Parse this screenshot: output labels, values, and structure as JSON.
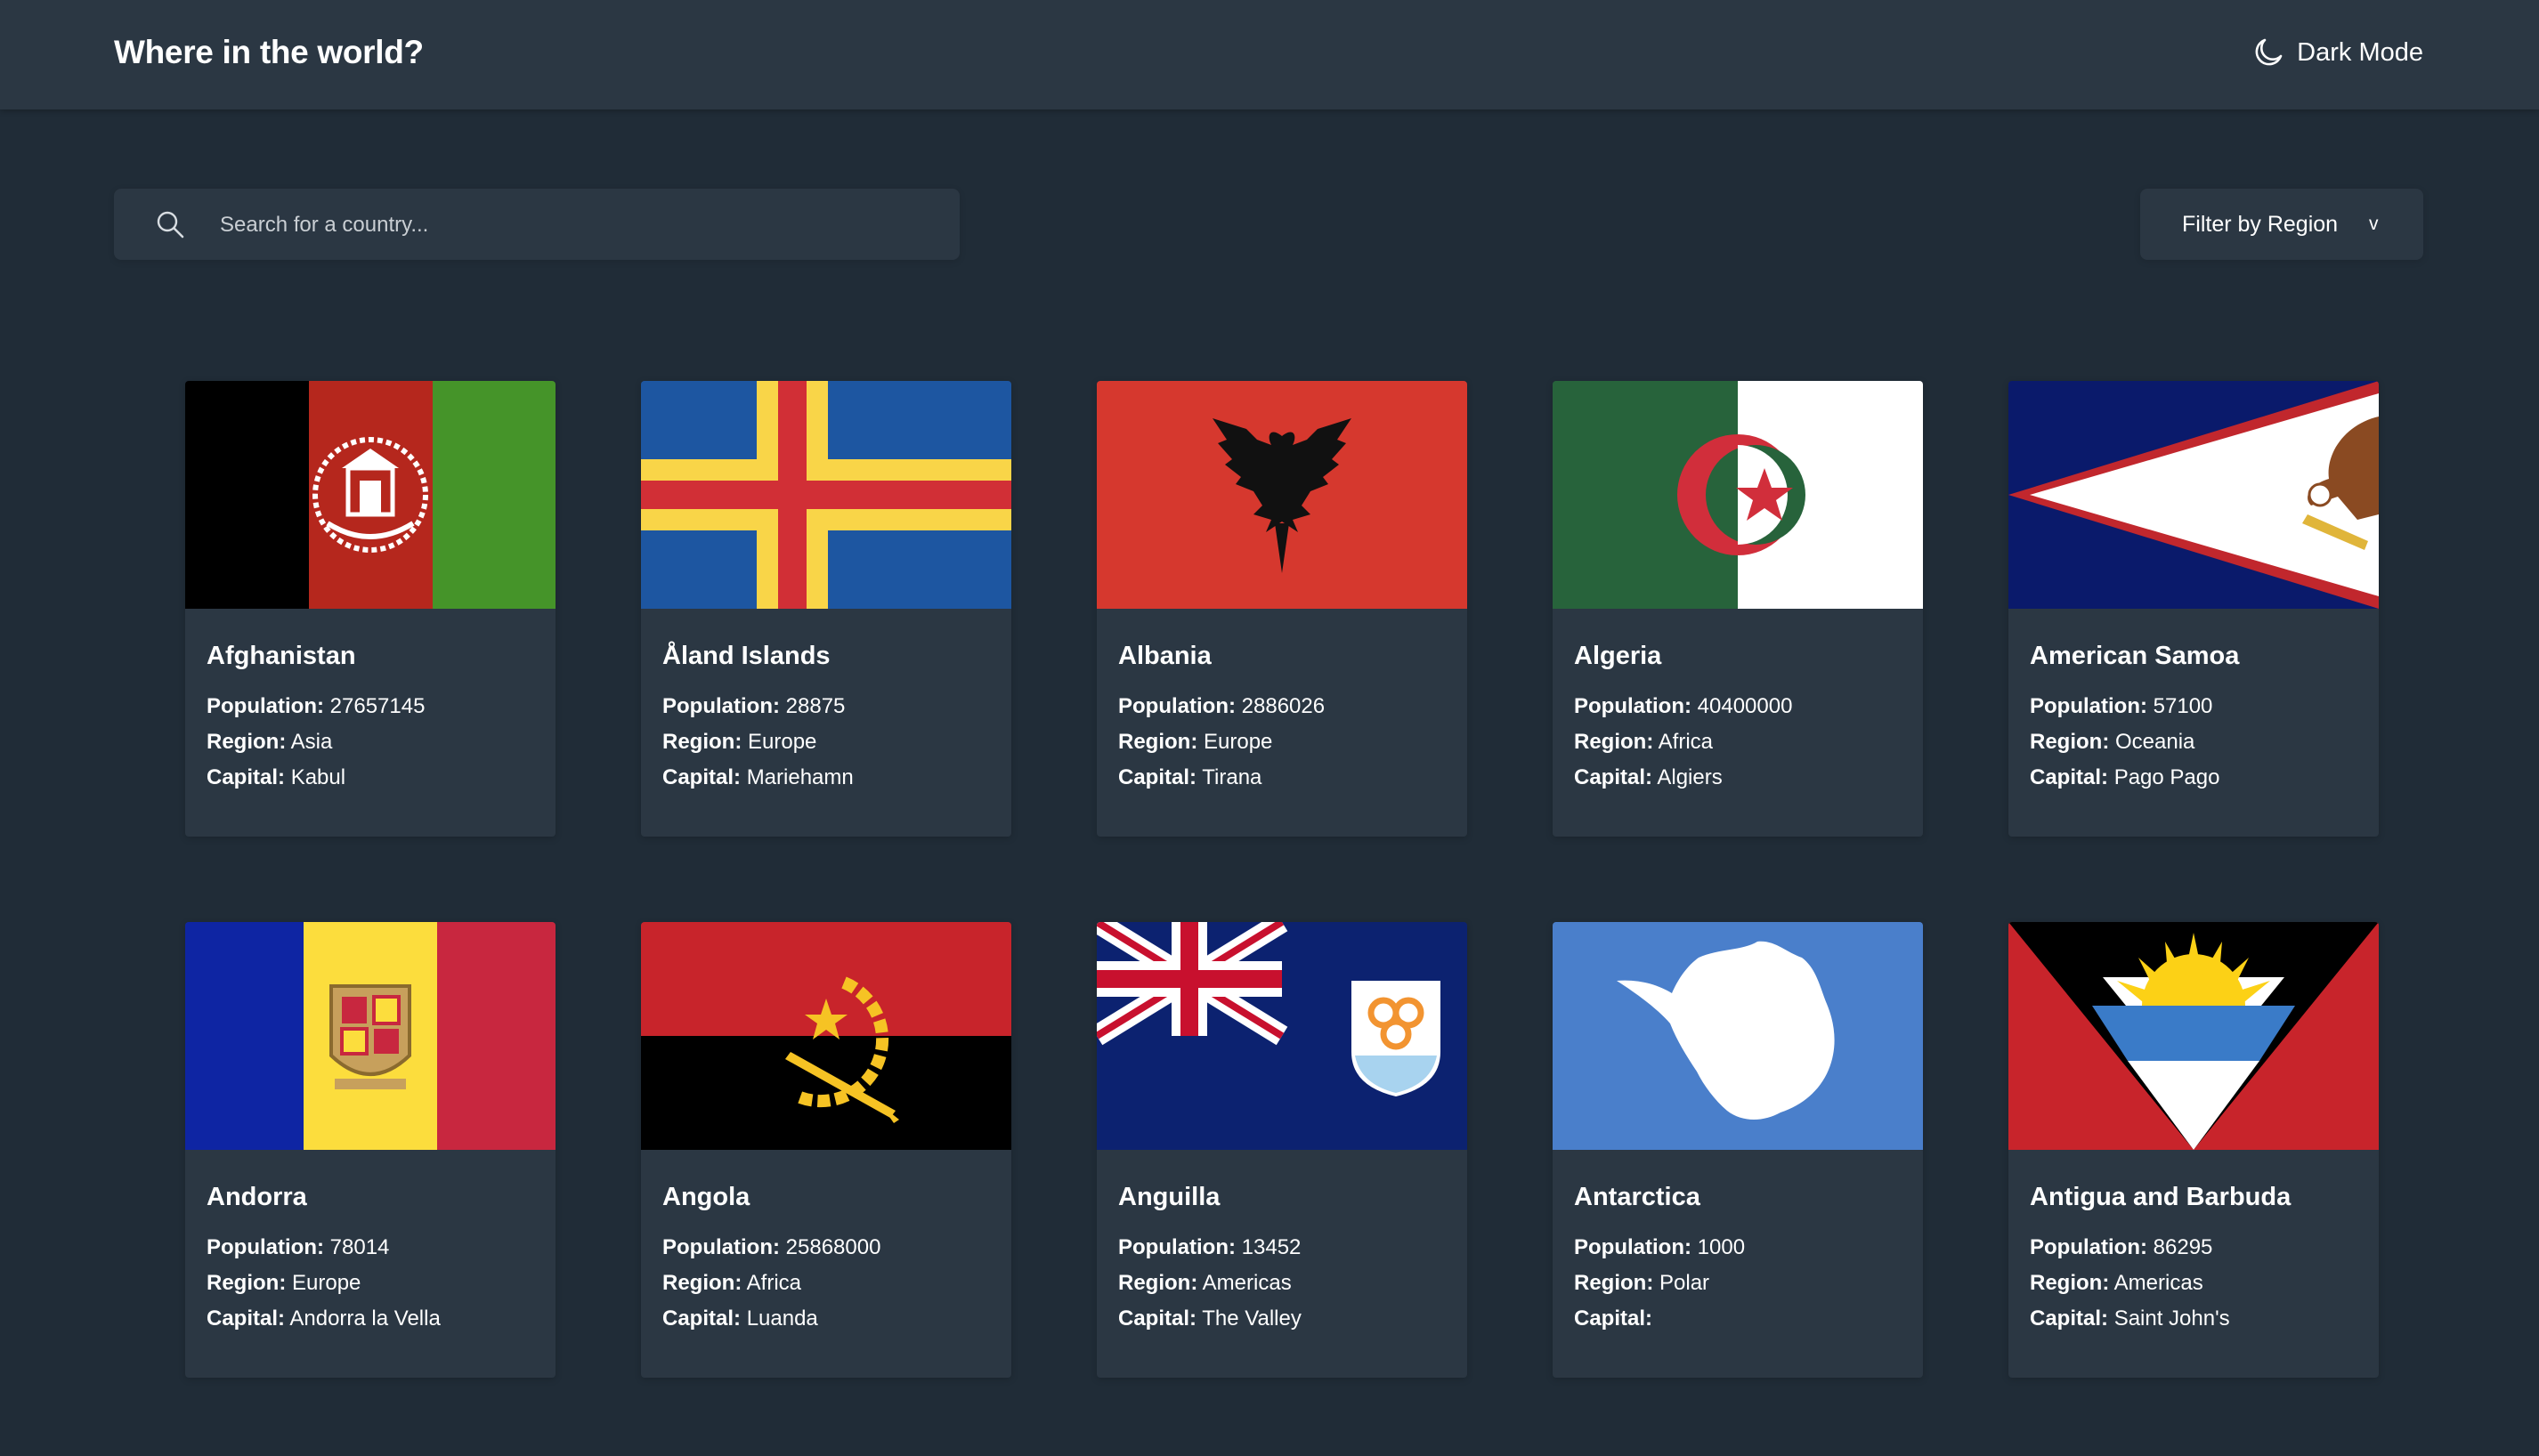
{
  "header": {
    "title": "Where in the world?",
    "mode_label": "Dark Mode",
    "mode_icon": "moon-icon"
  },
  "search": {
    "placeholder": "Search for a country...",
    "value": "",
    "icon": "search-icon"
  },
  "filter": {
    "label": "Filter by Region",
    "chevron": "v"
  },
  "labels": {
    "population": "Population:",
    "region": "Region:",
    "capital": "Capital:"
  },
  "countries": [
    {
      "name": "Afghanistan",
      "population": "27657145",
      "region": "Asia",
      "capital": "Kabul",
      "flag": "afghanistan-flag"
    },
    {
      "name": "Åland Islands",
      "population": "28875",
      "region": "Europe",
      "capital": "Mariehamn",
      "flag": "aland-islands-flag"
    },
    {
      "name": "Albania",
      "population": "2886026",
      "region": "Europe",
      "capital": "Tirana",
      "flag": "albania-flag"
    },
    {
      "name": "Algeria",
      "population": "40400000",
      "region": "Africa",
      "capital": "Algiers",
      "flag": "algeria-flag"
    },
    {
      "name": "American Samoa",
      "population": "57100",
      "region": "Oceania",
      "capital": "Pago Pago",
      "flag": "american-samoa-flag"
    },
    {
      "name": "Andorra",
      "population": "78014",
      "region": "Europe",
      "capital": "Andorra la Vella",
      "flag": "andorra-flag"
    },
    {
      "name": "Angola",
      "population": "25868000",
      "region": "Africa",
      "capital": "Luanda",
      "flag": "angola-flag"
    },
    {
      "name": "Anguilla",
      "population": "13452",
      "region": "Americas",
      "capital": "The Valley",
      "flag": "anguilla-flag"
    },
    {
      "name": "Antarctica",
      "population": "1000",
      "region": "Polar",
      "capital": "",
      "flag": "antarctica-flag"
    },
    {
      "name": "Antigua and Barbuda",
      "population": "86295",
      "region": "Americas",
      "capital": "Saint John's",
      "flag": "antigua-and-barbuda-flag"
    }
  ],
  "colors": {
    "background": "#202c37",
    "element": "#2b3743",
    "text": "#ffffff"
  }
}
